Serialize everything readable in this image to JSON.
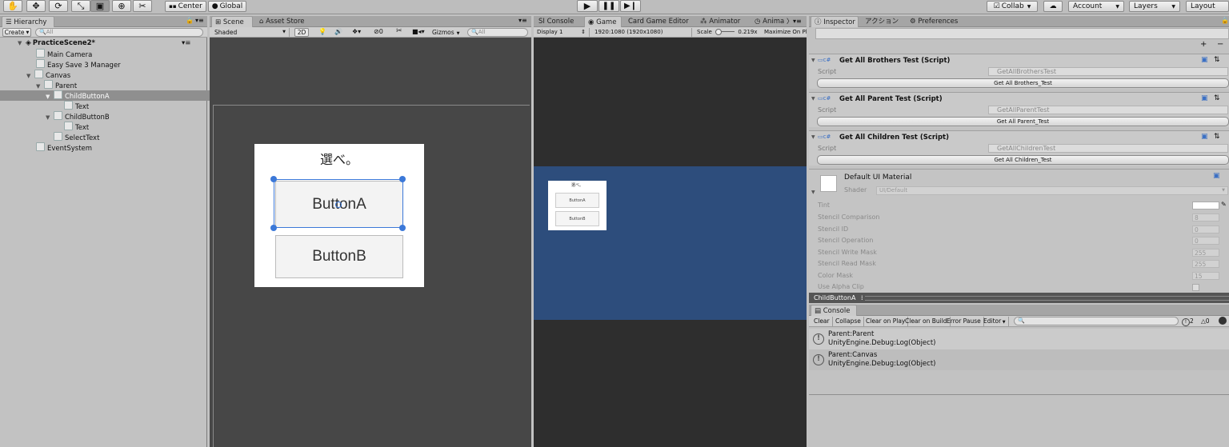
{
  "toolbar": {
    "pivot_label": "Center",
    "space_label": "Global",
    "collab_label": "Collab",
    "account_label": "Account",
    "layers_label": "Layers",
    "layout_label": "Layout"
  },
  "hierarchy": {
    "tab_label": "Hierarchy",
    "create_label": "Create",
    "search_placeholder": "All",
    "scene_name": "PracticeScene2*",
    "items": [
      {
        "label": "Main Camera"
      },
      {
        "label": "Easy Save 3 Manager"
      },
      {
        "label": "Canvas"
      },
      {
        "label": "Parent"
      },
      {
        "label": "ChildButtonA"
      },
      {
        "label": "Text"
      },
      {
        "label": "ChildButtonB"
      },
      {
        "label": "Text"
      },
      {
        "label": "SelectText"
      },
      {
        "label": "EventSystem"
      }
    ]
  },
  "scene": {
    "tabs": [
      {
        "label": "Scene"
      },
      {
        "label": "Asset Store"
      }
    ],
    "shading": "Shaded",
    "mode_2d": "2D",
    "hidden_count": "0",
    "gizmos": "Gizmos",
    "search_placeholder": "All",
    "panel_title": "選べ。",
    "button_a": "ButtonA",
    "button_b": "ButtonB"
  },
  "game": {
    "tabs": [
      {
        "label": "SI Console"
      },
      {
        "label": "Game"
      },
      {
        "label": "Card Game Editor"
      },
      {
        "label": "Animator"
      },
      {
        "label": "Anima"
      }
    ],
    "display": "Display 1",
    "resolution": "1920:1080 (1920x1080)",
    "scale_label": "Scale",
    "scale_value": "0.219x",
    "maximize": "Maximize On Pl",
    "panel_title": "選べ。",
    "button_a": "ButtonA",
    "button_b": "ButtonB"
  },
  "inspector": {
    "tabs": [
      {
        "label": "Inspector"
      },
      {
        "label": "アクション"
      },
      {
        "label": "Preferences"
      }
    ],
    "add_symbol": "+",
    "remove_symbol": "−",
    "script_label": "Script",
    "components": [
      {
        "title": "Get All Brothers Test (Script)",
        "script": "GetAllBrothersTest",
        "button": "Get All Brothers_Test",
        "end": "0"
      },
      {
        "title": "Get All Parent Test (Script)",
        "script": "GetAllParentTest",
        "button": "Get All Parent_Test",
        "end": "0"
      },
      {
        "title": "Get All Children Test (Script)",
        "script": "GetAllChildrenTest",
        "button": "Get All Children_Test",
        "end": "0"
      }
    ],
    "material": {
      "name": "Default UI Material",
      "shader_label": "Shader",
      "shader_value": "UI/Default",
      "props": [
        {
          "label": "Tint",
          "value": ""
        },
        {
          "label": "Stencil Comparison",
          "value": "8"
        },
        {
          "label": "Stencil ID",
          "value": "0"
        },
        {
          "label": "Stencil Operation",
          "value": "0"
        },
        {
          "label": "Stencil Write Mask",
          "value": "255"
        },
        {
          "label": "Stencil Read Mask",
          "value": "255"
        },
        {
          "label": "Color Mask",
          "value": "15"
        },
        {
          "label": "Use Alpha Clip",
          "value": ""
        }
      ]
    },
    "preview_label": "ChildButtonA"
  },
  "console": {
    "tab_label": "Console",
    "buttons": [
      {
        "label": "Clear"
      },
      {
        "label": "Collapse"
      },
      {
        "label": "Clear on Play"
      },
      {
        "label": "Clear on Build"
      },
      {
        "label": "Error Pause"
      },
      {
        "label": "Editor"
      }
    ],
    "warn_count": "2",
    "error_count": "0",
    "logs": [
      {
        "line1": "Parent:Parent",
        "line2": "UnityEngine.Debug:Log(Object)"
      },
      {
        "line1": "Parent:Canvas",
        "line2": "UnityEngine.Debug:Log(Object)"
      }
    ]
  },
  "colors": {
    "editor_bg": "#c2c2c2",
    "scene_bg": "#474747",
    "game_bg": "#2e2e2e",
    "game_canvas": "#2d4d7c",
    "selection": "#8f8f8f",
    "handle": "#3b78d8"
  }
}
